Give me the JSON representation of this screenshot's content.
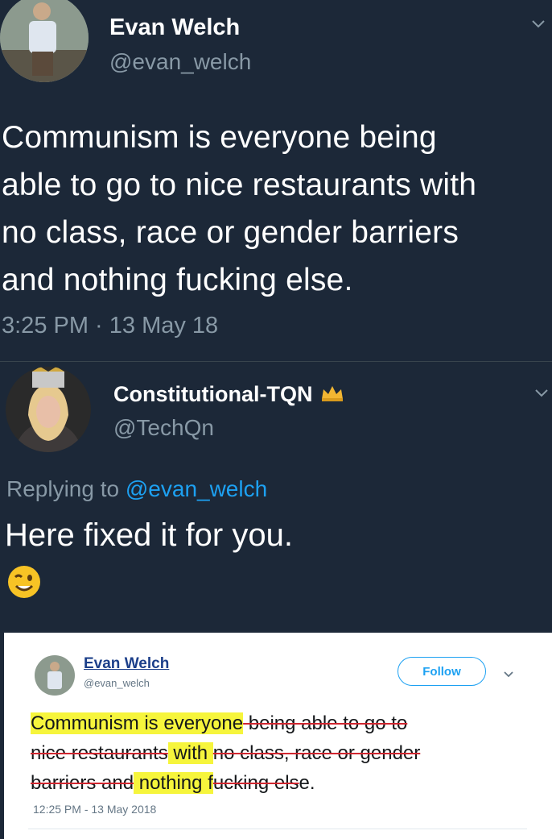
{
  "tweet1": {
    "name": "Evan Welch",
    "handle": "@evan_welch",
    "text_lines": [
      "Communism is everyone being",
      "able to go to nice restaurants with",
      "no class, race or gender barriers",
      "and nothing fucking else."
    ],
    "time": "3:25 PM · 13 May 18"
  },
  "tweet2": {
    "name": "Constitutional-TQN",
    "handle": "@TechQn",
    "replying_prefix": "Replying to ",
    "replying_handle": "@evan_welch",
    "text": "Here fixed it for you.",
    "emoji": "😉"
  },
  "card": {
    "name": "Evan Welch",
    "handle": "@evan_welch",
    "follow_label": "Follow",
    "line1_kept": "Communism is everyone",
    "line1_struck": " being able to go to",
    "line2_struck": "nice restaurants",
    "line2_kept": " with ",
    "line2_struck2": "no class, race or gender",
    "line3_struck": "barriers and",
    "line3_kept": " nothing ",
    "line3_kept2": "f",
    "line3_struck2": "ucking els",
    "line3_kept3": "e.",
    "time": "12:25 PM - 13 May 2018"
  }
}
